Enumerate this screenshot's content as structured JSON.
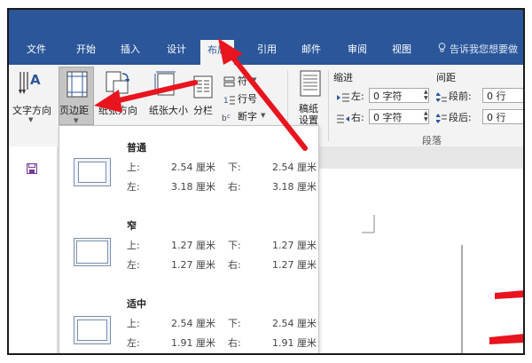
{
  "tabs": [
    {
      "label": "文件"
    },
    {
      "label": "开始"
    },
    {
      "label": "插入"
    },
    {
      "label": "设计"
    },
    {
      "label": "布局"
    },
    {
      "label": "引用"
    },
    {
      "label": "邮件"
    },
    {
      "label": "审阅"
    },
    {
      "label": "视图"
    }
  ],
  "active_tab": "布局",
  "tell_me": "告诉我您想要做",
  "ribbon": {
    "text_direction": "文字方向",
    "margins": "页边距",
    "orientation": "纸张方向",
    "size": "纸张大小",
    "columns": "分栏",
    "breaks": "符",
    "line_numbers": "行号",
    "hyphenation": "断字",
    "draft_paper": "稿纸设置",
    "indent": {
      "title": "缩进",
      "left_label": "左:",
      "left_value": "0 字符",
      "right_label": "右:",
      "right_value": "0 字符"
    },
    "spacing": {
      "title": "间距",
      "before_label": "段前:",
      "before_value": "0 行",
      "after_label": "段后:",
      "after_value": "0 行"
    },
    "paragraph_group": "段落"
  },
  "margin_options": [
    {
      "name": "普通",
      "top_label": "上:",
      "top": "2.54 厘米",
      "bottom_label": "下:",
      "bottom": "2.54 厘米",
      "left_label": "左:",
      "left": "3.18 厘米",
      "right_label": "右:",
      "right": "3.18 厘米"
    },
    {
      "name": "窄",
      "top_label": "上:",
      "top": "1.27 厘米",
      "bottom_label": "下:",
      "bottom": "1.27 厘米",
      "left_label": "左:",
      "left": "1.27 厘米",
      "right_label": "右:",
      "right": "1.27 厘米"
    },
    {
      "name": "适中",
      "top_label": "上:",
      "top": "2.54 厘米",
      "bottom_label": "下:",
      "bottom": "2.54 厘米",
      "left_label": "左:",
      "left": "1.91 厘米",
      "right_label": "右:",
      "right": "1.91 厘米"
    }
  ],
  "colors": {
    "ribbon_blue": "#2b579a",
    "annotation_red": "#e8141e"
  }
}
